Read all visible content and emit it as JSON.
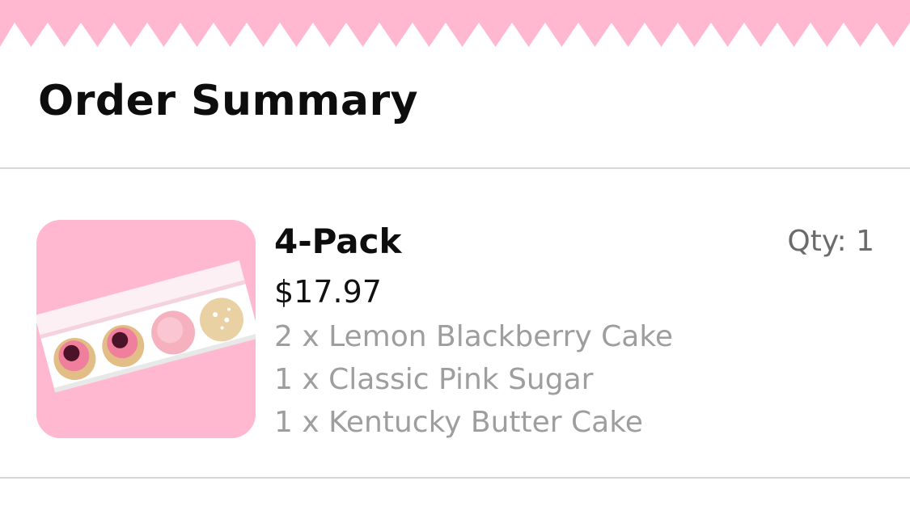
{
  "header": {
    "title": "Order Summary"
  },
  "order": {
    "items": [
      {
        "name": "4-Pack",
        "qty_label": "Qty: 1",
        "price": "$17.97",
        "contents": [
          "2 x Lemon Blackberry Cake",
          "1 x Classic Pink Sugar",
          "1 x Kentucky Butter Cake"
        ]
      }
    ]
  },
  "colors": {
    "brand_pink": "#ffb8cf",
    "text_primary": "#0d0d0d",
    "text_secondary": "#9e9e9e",
    "qty_text": "#6b6b6b",
    "divider": "#d6d6d6"
  },
  "icons": {
    "header_border": "pink-zigzag-border",
    "product_image": "cookie-4-pack-box-image"
  }
}
